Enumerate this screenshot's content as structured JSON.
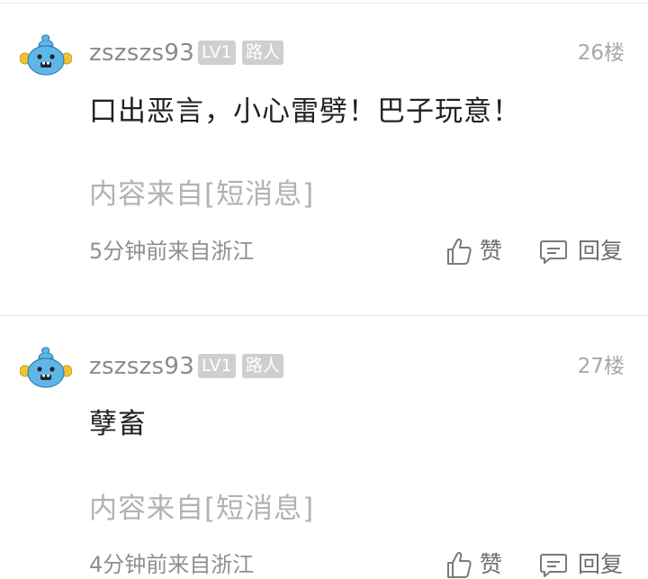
{
  "comments": [
    {
      "username": "zszszs93",
      "level": "LV1",
      "role": "路人",
      "floor": "26楼",
      "content": "口出恶言，小心雷劈！巴子玩意！",
      "source": "内容来自[短消息]",
      "time_location": "5分钟前来自浙江",
      "like_label": "赞",
      "reply_label": "回复",
      "avatar_icon": "blue-monster-avatar-icon"
    },
    {
      "username": "zszszs93",
      "level": "LV1",
      "role": "路人",
      "floor": "27楼",
      "content": "孽畜",
      "source": "内容来自[短消息]",
      "time_location": "4分钟前来自浙江",
      "like_label": "赞",
      "reply_label": "回复",
      "avatar_icon": "blue-monster-avatar-icon"
    }
  ],
  "colors": {
    "badge_bg": "#cfcfcf",
    "avatar_blue": "#5fb7e8",
    "avatar_yellow": "#f2c232"
  }
}
